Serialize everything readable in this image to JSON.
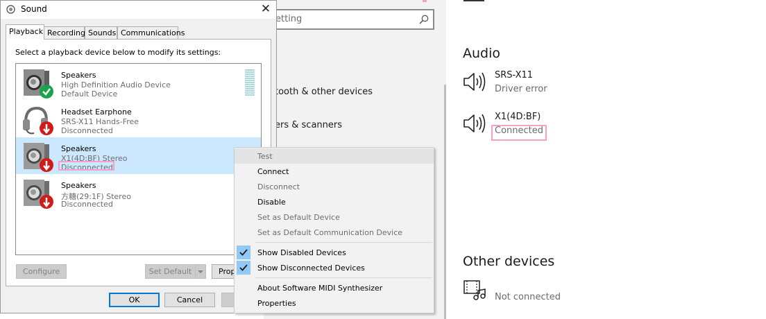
{
  "settings": {
    "search_placeholder": "etting",
    "links": [
      "tooth & other devices",
      "ers & scanners"
    ],
    "audio": {
      "heading": "Audio",
      "devices": [
        {
          "name": "SRS-X11",
          "status": "Driver error",
          "icon": "speaker-icon"
        },
        {
          "name": "X1(4D:BF)",
          "status": "Connected",
          "icon": "speaker-icon"
        }
      ]
    },
    "other": {
      "heading": "Other devices",
      "devices": [
        {
          "name": "",
          "status": "Not connected",
          "icon": "media-device-icon"
        }
      ]
    }
  },
  "dialog": {
    "title": "Sound",
    "close_glyph": "✕",
    "tabs": [
      "Playback",
      "Recording",
      "Sounds",
      "Communications"
    ],
    "active_tab": "Playback",
    "instruction": "Select a playback device below to modify its settings:",
    "devices": [
      {
        "name": "Speakers",
        "detail": "High Definition Audio Device",
        "status": "Default Device",
        "icon": "speaker-default-icon",
        "selected": false
      },
      {
        "name": "Headset Earphone",
        "detail": "SRS-X11 Hands-Free",
        "status": "Disconnected",
        "icon": "headset-disconnected-icon",
        "selected": false
      },
      {
        "name": "Speakers",
        "detail": "X1(4D:BF) Stereo",
        "status": "Disconnected",
        "icon": "speaker-disconnected-icon",
        "selected": true
      },
      {
        "name": "Speakers",
        "detail": "方糖(29:1F) Stereo",
        "status": "Disconnected",
        "icon": "speaker-disconnected-icon",
        "selected": false
      }
    ],
    "buttons": {
      "configure": "Configure",
      "set_default": "Set Default",
      "properties": "Prop",
      "ok": "OK",
      "cancel": "Cancel"
    }
  },
  "context_menu": {
    "items": [
      {
        "label": "Test",
        "enabled": false,
        "checked": false,
        "highlighted": true
      },
      {
        "label": "Connect",
        "enabled": true,
        "checked": false
      },
      {
        "label": "Disconnect",
        "enabled": false,
        "checked": false
      },
      {
        "label": "Disable",
        "enabled": true,
        "checked": false
      },
      {
        "label": "Set as Default Device",
        "enabled": false,
        "checked": false
      },
      {
        "label": "Set as Default Communication Device",
        "enabled": false,
        "checked": false
      },
      {
        "label": "Show Disabled Devices",
        "enabled": true,
        "checked": true
      },
      {
        "label": "Show Disconnected Devices",
        "enabled": true,
        "checked": true
      },
      {
        "label": "About Software MIDI Synthesizer",
        "enabled": true,
        "checked": false
      },
      {
        "label": "Properties",
        "enabled": true,
        "checked": false
      }
    ]
  },
  "colors": {
    "selection": "#cce8ff",
    "highlight_box": "#f3a1c6",
    "check_bg": "#90c8f6",
    "accent": "#0078d7"
  }
}
